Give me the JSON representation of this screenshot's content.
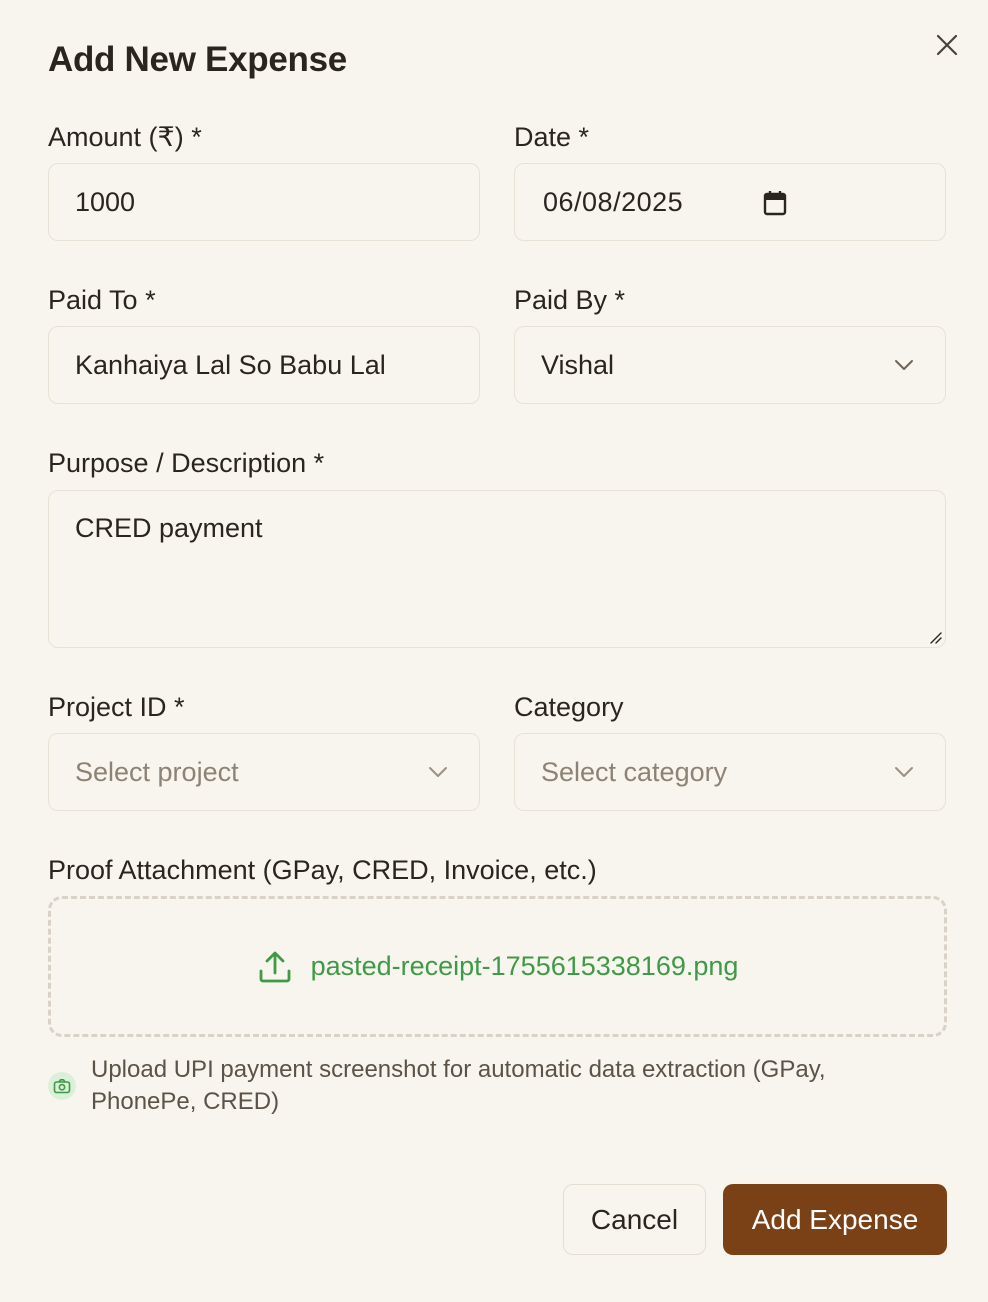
{
  "dialog": {
    "title": "Add New Expense",
    "close_icon": "close-icon"
  },
  "form": {
    "amount": {
      "label": "Amount (₹) *",
      "value": "1000"
    },
    "date": {
      "label": "Date *",
      "value": "06/08/2025",
      "icon": "calendar-icon"
    },
    "paid_to": {
      "label": "Paid To *",
      "value": "Kanhaiya Lal So Babu Lal"
    },
    "paid_by": {
      "label": "Paid By *",
      "value": "Vishal"
    },
    "purpose": {
      "label": "Purpose / Description *",
      "value": "CRED payment"
    },
    "project": {
      "label": "Project ID *",
      "placeholder": "Select project"
    },
    "category": {
      "label": "Category",
      "placeholder": "Select category"
    },
    "proof": {
      "label": "Proof Attachment (GPay, CRED, Invoice, etc.)",
      "filename": "pasted-receipt-1755615338169.png",
      "icon": "upload-icon"
    },
    "hint": {
      "icon": "camera-icon",
      "text": "Upload UPI payment screenshot for automatic data extraction (GPay, PhonePe, CRED)"
    }
  },
  "actions": {
    "cancel_label": "Cancel",
    "submit_label": "Add Expense"
  },
  "colors": {
    "background": "#f8f5ee",
    "primary": "#7a4117",
    "success_text": "#3f9a47",
    "border": "#e8e2d6"
  }
}
